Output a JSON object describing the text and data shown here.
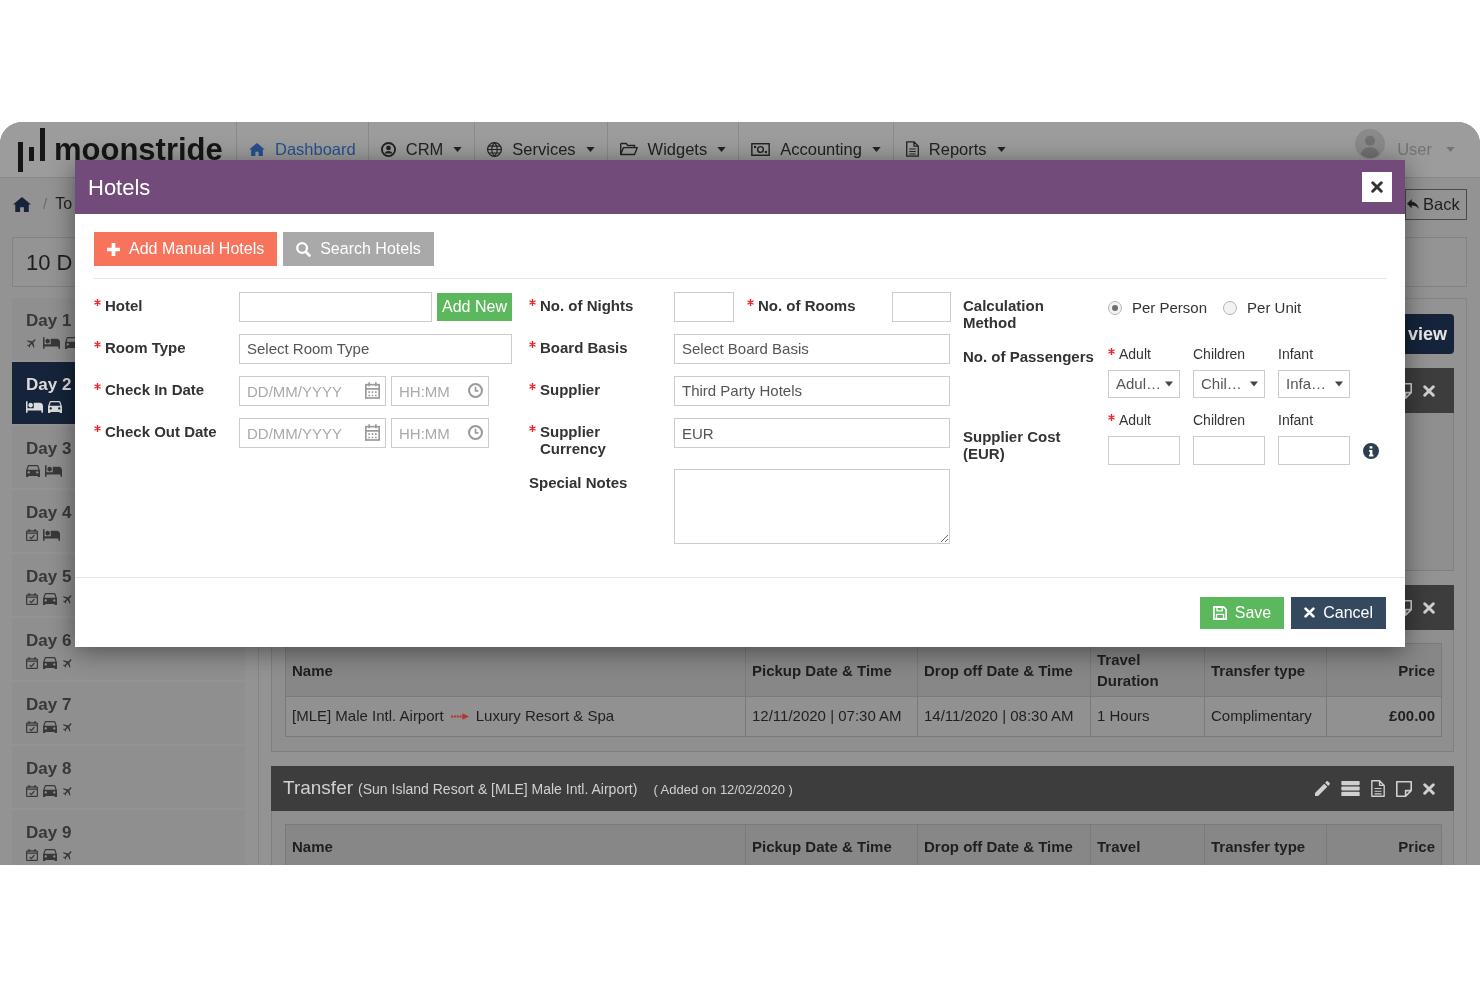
{
  "navbar": {
    "logo": "moonstride",
    "items": [
      {
        "label": "Dashboard",
        "selected": true,
        "dropdown": false
      },
      {
        "label": "CRM",
        "selected": false,
        "dropdown": true
      },
      {
        "label": "Services",
        "selected": false,
        "dropdown": true
      },
      {
        "label": "Widgets",
        "selected": false,
        "dropdown": true
      },
      {
        "label": "Accounting",
        "selected": false,
        "dropdown": true
      },
      {
        "label": "Reports",
        "selected": false,
        "dropdown": true
      }
    ],
    "user": {
      "name": "User"
    }
  },
  "breadcrumb": {
    "separator": "/",
    "items": [
      "To"
    ]
  },
  "back_button": {
    "label": "Back"
  },
  "page_title": "10 D",
  "sidebar": {
    "days": [
      {
        "label": "Day 1",
        "selected": false,
        "services": [
          {
            "kind": "flight"
          },
          {
            "kind": "hotel"
          },
          {
            "kind": "transfer"
          }
        ]
      },
      {
        "label": "Day 2",
        "selected": true,
        "services": [
          {
            "kind": "hotel"
          },
          {
            "kind": "transfer"
          }
        ]
      },
      {
        "label": "Day 3",
        "selected": false,
        "services": [
          {
            "kind": "transfer"
          },
          {
            "kind": "hotel"
          }
        ]
      },
      {
        "label": "Day 4",
        "selected": false,
        "services": [
          {
            "kind": "activity"
          },
          {
            "kind": "hotel"
          }
        ]
      },
      {
        "label": "Day 5",
        "selected": false,
        "services": [
          {
            "kind": "activity"
          },
          {
            "kind": "transfer"
          },
          {
            "kind": "flight"
          }
        ]
      },
      {
        "label": "Day 6",
        "selected": false,
        "services": [
          {
            "kind": "activity"
          },
          {
            "kind": "transfer"
          },
          {
            "kind": "flight"
          }
        ]
      },
      {
        "label": "Day 7",
        "selected": false,
        "services": [
          {
            "kind": "activity"
          },
          {
            "kind": "transfer"
          },
          {
            "kind": "flight"
          }
        ]
      },
      {
        "label": "Day 8",
        "selected": false,
        "services": [
          {
            "kind": "activity"
          },
          {
            "kind": "transfer"
          },
          {
            "kind": "flight"
          }
        ]
      },
      {
        "label": "Day 9",
        "selected": false,
        "services": [
          {
            "kind": "activity"
          },
          {
            "kind": "transfer"
          },
          {
            "kind": "flight"
          }
        ]
      }
    ]
  },
  "content": {
    "view_button": {
      "label": "view"
    },
    "sections": [
      {
        "actions": [
          {
            "kind": "note"
          },
          {
            "kind": "delete"
          }
        ]
      },
      {
        "actions": [
          {
            "kind": "note"
          },
          {
            "kind": "delete"
          }
        ],
        "table": {
          "columns": [
            "Name",
            "Pickup Date & Time",
            "Drop off Date & Time",
            "Travel Duration",
            "Transfer type",
            "Price"
          ],
          "rows": [
            {
              "cells": [
                {
                  "kind": "route",
                  "from": "[MLE] Male Intl. Airport",
                  "to": "Luxury Resort & Spa"
                },
                {
                  "kind": "text",
                  "text": "12/11/2020 | 07:30 AM"
                },
                {
                  "kind": "text",
                  "text": "14/11/2020 | 08:30 AM"
                },
                {
                  "kind": "text",
                  "text": "1 Hours"
                },
                {
                  "kind": "text",
                  "text": "Complimentary"
                },
                {
                  "kind": "amount",
                  "text": "£00.00"
                }
              ]
            }
          ]
        }
      },
      {
        "title": "Transfer",
        "subtitle": "(Sun Island Resort & [MLE] Male Intl. Airport)",
        "added": "( Added on 12/02/2020 )",
        "actions": [
          {
            "kind": "edit"
          },
          {
            "kind": "list"
          },
          {
            "kind": "document"
          },
          {
            "kind": "note"
          },
          {
            "kind": "delete"
          }
        ],
        "table": {
          "columns": [
            "Name",
            "Pickup Date & Time",
            "Drop off Date & Time",
            "Travel",
            "Transfer type",
            "Price"
          ]
        }
      }
    ]
  },
  "modal": {
    "title": "Hotels",
    "modes": [
      {
        "label": "Add Manual Hotels",
        "selected": true
      },
      {
        "label": "Search Hotels",
        "selected": false
      }
    ],
    "form": {
      "columns": [
        {
          "fields": [
            {
              "kind": "text_with_button",
              "label": "Hotel",
              "required": true,
              "button": "Add New"
            },
            {
              "kind": "select",
              "label": "Room Type",
              "required": true,
              "value": "Select Room Type"
            },
            {
              "kind": "datetime",
              "label": "Check In Date",
              "required": true,
              "date": {
                "placeholder": "DD/MM/YYYY"
              },
              "time": {
                "placeholder": "HH:MM"
              }
            },
            {
              "kind": "datetime",
              "label": "Check Out Date",
              "required": true,
              "date": {
                "placeholder": "DD/MM/YYYY"
              },
              "time": {
                "placeholder": "HH:MM"
              }
            }
          ]
        },
        {
          "fields": [
            {
              "kind": "pair",
              "label": "No. of Nights",
              "required": true,
              "second": {
                "label": "No. of Rooms",
                "required": true
              }
            },
            {
              "kind": "select",
              "label": "Board Basis",
              "required": true,
              "value": "Select Board Basis"
            },
            {
              "kind": "select",
              "label": "Supplier",
              "required": true,
              "value": "Third Party Hotels"
            },
            {
              "kind": "text",
              "label": "Supplier Currency",
              "required": true,
              "value": "EUR"
            },
            {
              "kind": "textarea",
              "label": "Special Notes",
              "required": false
            }
          ]
        },
        {
          "fields": [
            {
              "kind": "radio",
              "label": "Calculation Method",
              "required": false,
              "options": [
                {
                  "label": "Per Person",
                  "selected": true
                },
                {
                  "label": "Per Unit",
                  "selected": false
                }
              ]
            },
            {
              "kind": "selects",
              "label": "No. of Passengers",
              "required": false,
              "inputs": [
                {
                  "label": "Adult",
                  "required": true,
                  "value": "Adul…"
                },
                {
                  "label": "Children",
                  "required": false,
                  "value": "Chil…"
                },
                {
                  "label": "Infant",
                  "required": false,
                  "value": "Infa…"
                }
              ]
            },
            {
              "kind": "inputs",
              "label": "Supplier Cost (EUR)",
              "required": false,
              "info": true,
              "inputs": [
                {
                  "label": "Adult",
                  "required": true
                },
                {
                  "label": "Children",
                  "required": false
                },
                {
                  "label": "Infant",
                  "required": false
                }
              ]
            }
          ]
        }
      ]
    },
    "buttons": [
      {
        "kind": "save",
        "label": "Save"
      },
      {
        "kind": "cancel",
        "label": "Cancel"
      }
    ]
  }
}
